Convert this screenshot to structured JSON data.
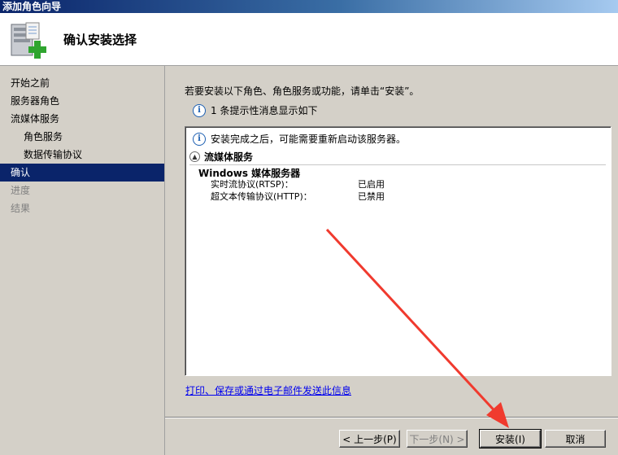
{
  "window": {
    "title": "添加角色向导"
  },
  "header": {
    "title": "确认安装选择",
    "icon": "server-add-icon"
  },
  "sidebar": {
    "items": [
      {
        "label": "开始之前",
        "state": "normal"
      },
      {
        "label": "服务器角色",
        "state": "normal"
      },
      {
        "label": "流媒体服务",
        "state": "normal"
      },
      {
        "label": "角色服务",
        "state": "normal",
        "sub": true
      },
      {
        "label": "数据传输协议",
        "state": "normal",
        "sub": true
      },
      {
        "label": "确认",
        "state": "active"
      },
      {
        "label": "进度",
        "state": "disabled"
      },
      {
        "label": "结果",
        "state": "disabled"
      }
    ]
  },
  "main": {
    "instruction": "若要安装以下角色、角色服务或功能，请单击“安装”。",
    "info_count": "1 条提示性消息显示如下",
    "panel": {
      "info_message": "安装完成之后，可能需要重新启动该服务器。",
      "section_title": "流媒体服务",
      "service_name": "Windows 媒体服务器",
      "rows": [
        {
          "label": "实时流协议(RTSP)：",
          "value": "已启用"
        },
        {
          "label": "超文本传输协议(HTTP)：",
          "value": "已禁用"
        }
      ]
    },
    "link": "打印、保存或通过电子邮件发送此信息"
  },
  "buttons": {
    "prev": "< 上一步(P)",
    "next": "下一步(N) >",
    "install": "安装(I)",
    "cancel": "取消"
  },
  "colors": {
    "selection": "#0a246a",
    "arrow": "#f03a2e",
    "link": "#0000ee"
  }
}
